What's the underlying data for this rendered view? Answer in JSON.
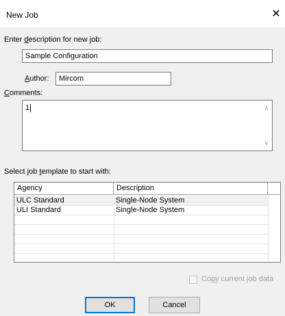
{
  "window": {
    "title": "New Job",
    "close_glyph": "✕"
  },
  "description": {
    "label_pre": "Enter ",
    "label_key": "d",
    "label_post": "escription for new job:",
    "value": "Sample Configuration"
  },
  "author": {
    "label_key": "A",
    "label_post": "uthor:",
    "value": "Mircom"
  },
  "comments": {
    "label_key": "C",
    "label_post": "omments:",
    "value": "1"
  },
  "template": {
    "label_pre": "Select job ",
    "label_key": "t",
    "label_post": "emplate to start with:",
    "columns": [
      "Agency",
      "Description"
    ],
    "rows": [
      {
        "agency": "ULC Standard",
        "description": "Single-Node System"
      },
      {
        "agency": "ULI Standard",
        "description": "Single-Node System"
      }
    ]
  },
  "copy_option": {
    "label_pre": "Co",
    "label_key": "p",
    "label_post": "y current job data",
    "checked": false
  },
  "buttons": {
    "ok": "OK",
    "cancel": "Cancel"
  }
}
